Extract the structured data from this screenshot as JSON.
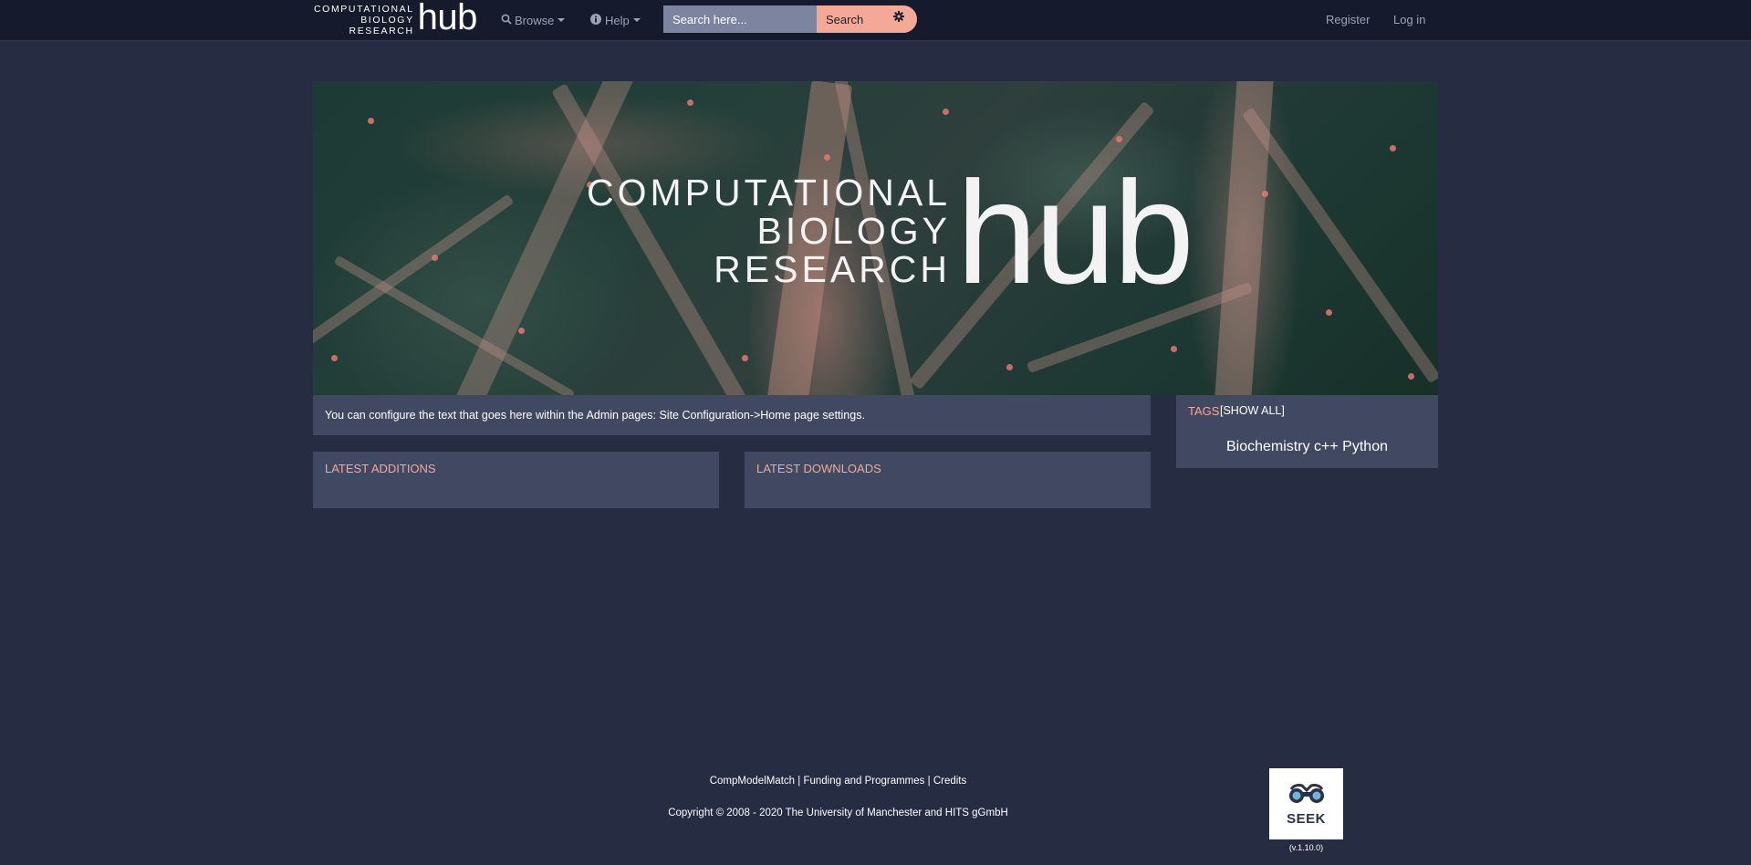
{
  "navbar": {
    "brand_small_lines": [
      "COMPUTATIONAL",
      "BIOLOGY",
      "RESEARCH"
    ],
    "brand_hub": "hub",
    "browse_label": "Browse",
    "help_label": "Help",
    "search_placeholder": "Search here...",
    "search_button": "Search",
    "register_label": "Register",
    "login_label": "Log in"
  },
  "banner": {
    "lines": [
      "COMPUTATIONAL",
      "BIOLOGY",
      "RESEARCH"
    ],
    "hub": "hub"
  },
  "intro_text": "You can configure the text that goes here within the Admin pages: Site Configuration->Home page settings.",
  "latest_additions_title": "LATEST ADDITIONS",
  "latest_downloads_title": "LATEST DOWNLOADS",
  "tags": {
    "title": "TAGS",
    "show_all": "[SHOW ALL]",
    "items": [
      "Biochemistry",
      "c++",
      "Python"
    ]
  },
  "footer": {
    "links": [
      "CompModelMatch",
      "Funding and Programmes",
      "Credits"
    ],
    "separator": " | ",
    "copyright": "Copyright © 2008 - 2020 The University of Manchester and HITS gGmbH",
    "seek_label": "SEEK",
    "version": "(v.1.10.0)"
  }
}
